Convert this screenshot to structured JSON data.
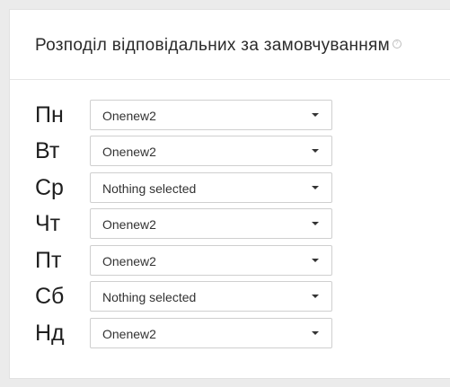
{
  "panel": {
    "title": "Розподіл відповідальних за замовчуванням",
    "help_icon": "question-circle-icon"
  },
  "days": [
    {
      "label": "Пн",
      "value": "Onenew2"
    },
    {
      "label": "Вт",
      "value": "Onenew2"
    },
    {
      "label": "Ср",
      "value": "Nothing selected"
    },
    {
      "label": "Чт",
      "value": "Onenew2"
    },
    {
      "label": "Пт",
      "value": "Onenew2"
    },
    {
      "label": "Сб",
      "value": "Nothing selected"
    },
    {
      "label": "Нд",
      "value": "Onenew2"
    }
  ]
}
